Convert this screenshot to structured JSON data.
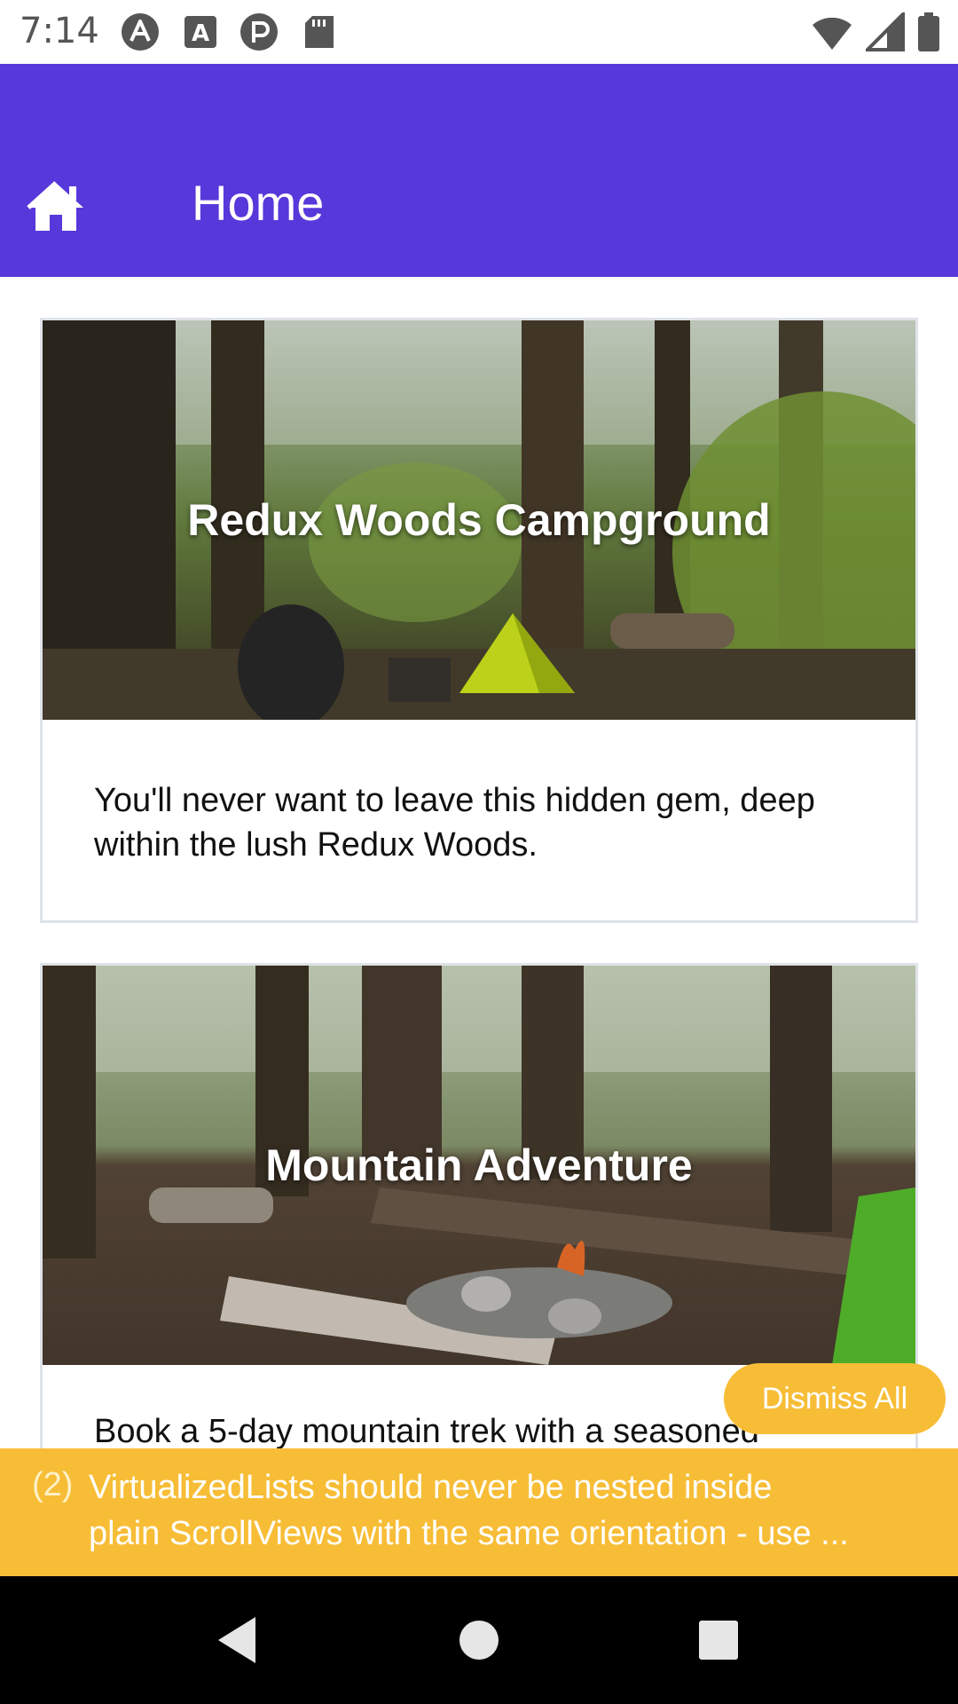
{
  "status_bar": {
    "time": "7:14",
    "left_icons": [
      "autofill-icon",
      "a-icon",
      "p-icon",
      "sd-card-icon"
    ],
    "right_icons": [
      "wifi-icon",
      "signal-icon",
      "battery-icon"
    ]
  },
  "app_bar": {
    "title": "Home",
    "icon": "home-icon",
    "color": "#5738da"
  },
  "cards": [
    {
      "title": "Redux Woods Campground",
      "description": "You'll never want to leave this hidden gem, deep within the lush Redux Woods."
    },
    {
      "title": "Mountain Adventure",
      "description": "Book a 5-day mountain trek with a seasoned"
    }
  ],
  "warning": {
    "dismiss_label": "Dismiss All",
    "count": "(2)",
    "message": "VirtualizedLists should never be nested inside\nplain ScrollViews with the same orientation - use ...",
    "color": "#f7bd36"
  },
  "nav_bar": {
    "buttons": [
      "back-icon",
      "home-circle-icon",
      "recents-icon"
    ]
  }
}
